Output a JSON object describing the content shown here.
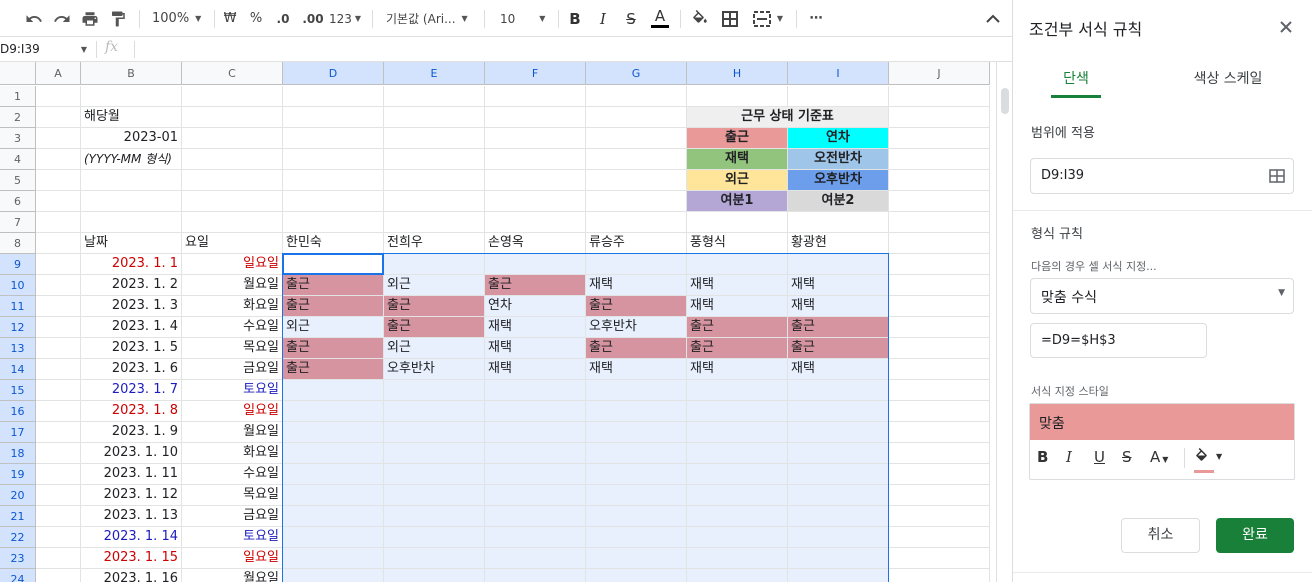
{
  "toolbar": {
    "zoom": "100%",
    "currency": "₩",
    "percent": "%",
    "dec_decrease": ".0",
    "dec_increase": ".00",
    "format_more": "123",
    "font": "기본값 (Ari...",
    "font_size": "10",
    "more": "⋯"
  },
  "formula_bar": {
    "name_box": "D9:I39",
    "fx": "fx",
    "content": ""
  },
  "columns": [
    "A",
    "B",
    "C",
    "D",
    "E",
    "F",
    "G",
    "H",
    "I",
    "J"
  ],
  "rows": [
    "1",
    "2",
    "3",
    "4",
    "5",
    "6",
    "7",
    "8",
    "9",
    "10",
    "11",
    "12",
    "13",
    "14",
    "15",
    "16",
    "17",
    "18",
    "19",
    "20",
    "21",
    "22",
    "23",
    "24"
  ],
  "cells": {
    "B2": "해당월",
    "B3": "2023-01",
    "B4": "(YYYY-MM 형식)",
    "H2": "근무 상태 기준표",
    "H3": "출근",
    "I3": "연차",
    "H4": "재택",
    "I4": "오전반차",
    "H5": "외근",
    "I5": "오후반차",
    "H6": "여분1",
    "I6": "여분2",
    "B8": "날짜",
    "C8": "요일",
    "D8": "한민숙",
    "E8": "전희우",
    "F8": "손영옥",
    "G8": "류승주",
    "H8": "풍형식",
    "I8": "황광현"
  },
  "date_rows": [
    {
      "date": "2023. 1. 1",
      "day": "일요일",
      "kind": "sun"
    },
    {
      "date": "2023. 1. 2",
      "day": "월요일",
      "kind": "wk"
    },
    {
      "date": "2023. 1. 3",
      "day": "화요일",
      "kind": "wk"
    },
    {
      "date": "2023. 1. 4",
      "day": "수요일",
      "kind": "wk"
    },
    {
      "date": "2023. 1. 5",
      "day": "목요일",
      "kind": "wk"
    },
    {
      "date": "2023. 1. 6",
      "day": "금요일",
      "kind": "wk"
    },
    {
      "date": "2023. 1. 7",
      "day": "토요일",
      "kind": "sat"
    },
    {
      "date": "2023. 1. 8",
      "day": "일요일",
      "kind": "sun"
    },
    {
      "date": "2023. 1. 9",
      "day": "월요일",
      "kind": "wk"
    },
    {
      "date": "2023. 1. 10",
      "day": "화요일",
      "kind": "wk"
    },
    {
      "date": "2023. 1. 11",
      "day": "수요일",
      "kind": "wk"
    },
    {
      "date": "2023. 1. 12",
      "day": "목요일",
      "kind": "wk"
    },
    {
      "date": "2023. 1. 13",
      "day": "금요일",
      "kind": "wk"
    },
    {
      "date": "2023. 1. 14",
      "day": "토요일",
      "kind": "sat"
    },
    {
      "date": "2023. 1. 15",
      "day": "일요일",
      "kind": "sun"
    },
    {
      "date": "2023. 1. 16",
      "day": "월요일",
      "kind": "wk"
    }
  ],
  "status": {
    "10": [
      "출근",
      "외근",
      "출근",
      "재택",
      "재택",
      "재택"
    ],
    "11": [
      "출근",
      "출근",
      "연차",
      "출근",
      "재택",
      "재택"
    ],
    "12": [
      "외근",
      "출근",
      "재택",
      "오후반차",
      "출근",
      "출근"
    ],
    "13": [
      "출근",
      "외근",
      "재택",
      "출근",
      "출근",
      "출근"
    ],
    "14": [
      "출근",
      "오후반차",
      "재택",
      "재택",
      "재택",
      "재택"
    ]
  },
  "colors": {
    "legend_chulgeun": "#ea9999",
    "legend_yeoncha": "#00ffff",
    "legend_jaetaek": "#93c47d",
    "legend_ojeon": "#9fc5e8",
    "legend_oegeun": "#ffe599",
    "legend_ohu": "#6d9eeb",
    "legend_yeobun1": "#b4a7d6",
    "legend_yeobun2": "#d9d9d9",
    "legend_header": "#efefef",
    "match_fill": "#d5949f",
    "range_fill": "#e8f0fe",
    "range_border": "#1a73e8",
    "sunday": "#cc0000",
    "saturday": "#1c1cbe",
    "primary": "#188038"
  },
  "panel": {
    "title": "조건부 서식 규칙",
    "tab_single": "단색",
    "tab_scale": "색상 스케일",
    "apply_label": "범위에 적용",
    "range_value": "D9:I39",
    "rules_label": "형식 규칙",
    "condition_label": "다음의 경우 셀 서식 지정...",
    "condition_value": "맞춤 수식",
    "formula_value": "=D9=$H$3",
    "style_label": "서식 지정 스타일",
    "style_preview": "맞춤",
    "cancel": "취소",
    "done": "완료"
  }
}
